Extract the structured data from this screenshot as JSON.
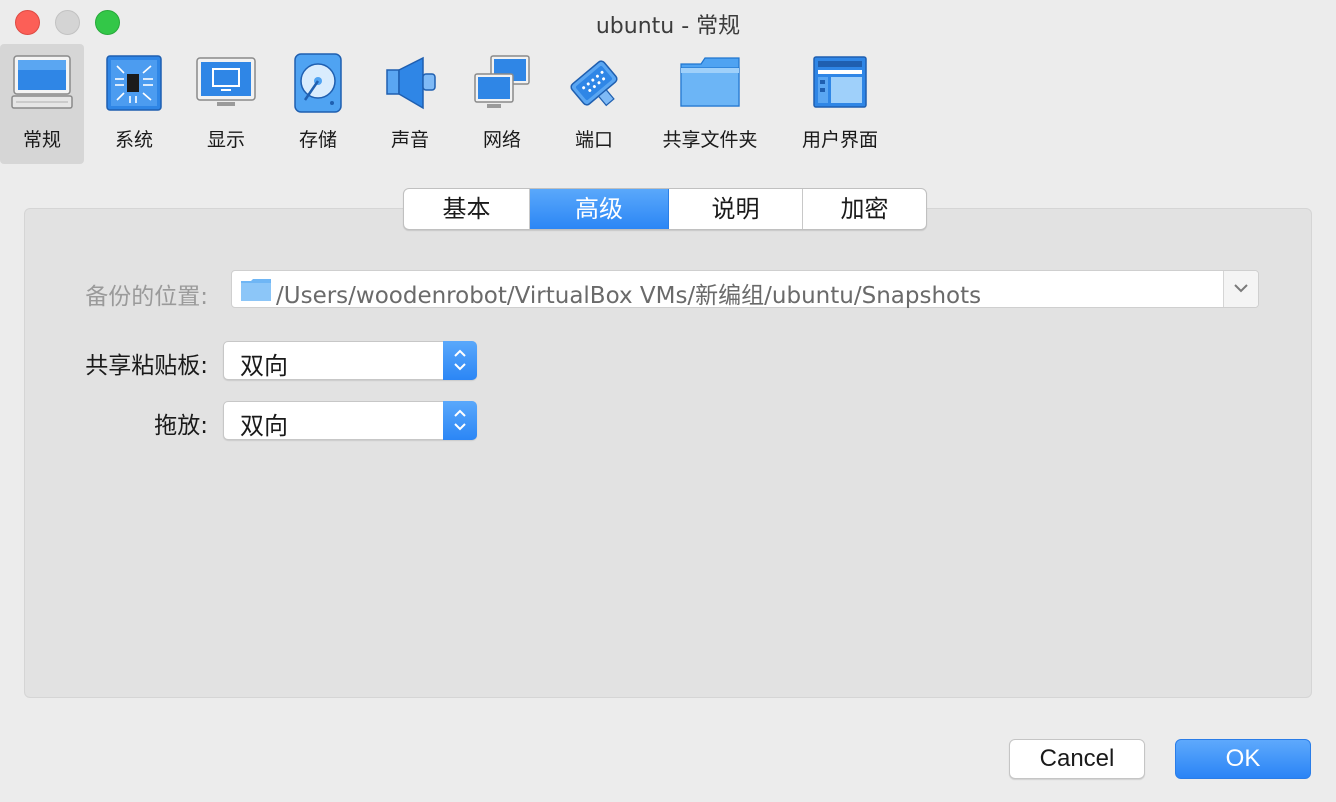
{
  "window": {
    "title": "ubuntu - 常规"
  },
  "toolbar": {
    "items": [
      {
        "label": "常规",
        "icon": "monitor-icon"
      },
      {
        "label": "系统",
        "icon": "chip-icon"
      },
      {
        "label": "显示",
        "icon": "display-icon"
      },
      {
        "label": "存储",
        "icon": "disk-icon"
      },
      {
        "label": "声音",
        "icon": "speaker-icon"
      },
      {
        "label": "网络",
        "icon": "network-icon"
      },
      {
        "label": "端口",
        "icon": "port-icon"
      },
      {
        "label": "共享文件夹",
        "icon": "folder-icon"
      },
      {
        "label": "用户界面",
        "icon": "ui-icon"
      }
    ],
    "active_index": 0
  },
  "tabs": {
    "items": [
      "基本",
      "高级",
      "说明",
      "加密"
    ],
    "selected": "高级"
  },
  "form": {
    "snapshot_label": "备份的位置:",
    "snapshot_path": "/Users/woodenrobot/VirtualBox VMs/新编组/ubuntu/Snapshots",
    "clipboard_label": "共享粘贴板:",
    "clipboard_value": "双向",
    "dragdrop_label": "拖放:",
    "dragdrop_value": "双向"
  },
  "buttons": {
    "cancel": "Cancel",
    "ok": "OK"
  },
  "colors": {
    "accent": "#2b86f5",
    "background": "#ececec",
    "panel": "#e2e2e2"
  }
}
